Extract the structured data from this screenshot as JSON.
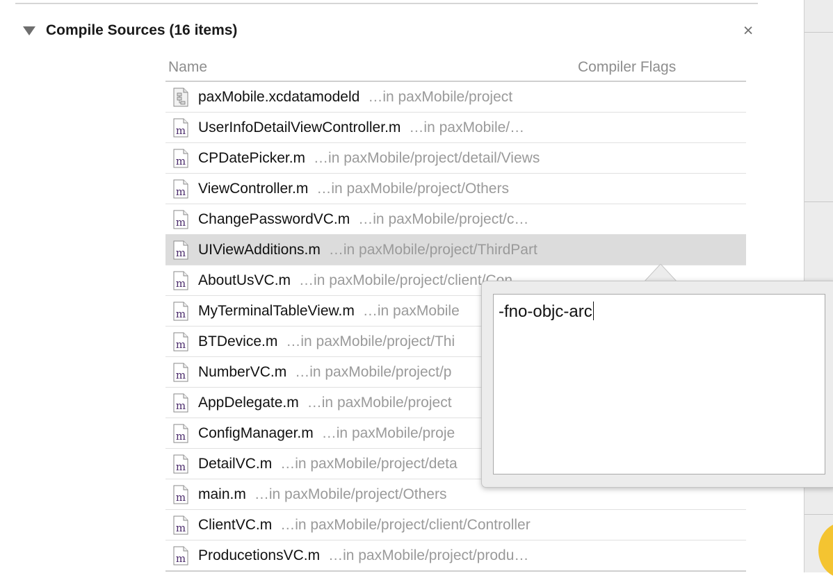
{
  "section": {
    "title": "Compile Sources (16 items)",
    "close_glyph": "×"
  },
  "columns": {
    "name": "Name",
    "flags": "Compiler Flags"
  },
  "files": [
    {
      "name": "paxMobile.xcdatamodeld",
      "path": "…in paxMobile/project",
      "icon": "datamodel-file-icon"
    },
    {
      "name": "UserInfoDetailViewController.m",
      "path": "…in paxMobile/…",
      "icon": "m-file-icon"
    },
    {
      "name": "CPDatePicker.m",
      "path": "…in paxMobile/project/detail/Views",
      "icon": "m-file-icon"
    },
    {
      "name": "ViewController.m",
      "path": "…in paxMobile/project/Others",
      "icon": "m-file-icon"
    },
    {
      "name": "ChangePasswordVC.m",
      "path": "…in paxMobile/project/c…",
      "icon": "m-file-icon"
    },
    {
      "name": "UIViewAdditions.m",
      "path": "…in paxMobile/project/ThirdPart",
      "icon": "m-file-icon",
      "selected": true
    },
    {
      "name": "AboutUsVC.m",
      "path": "…in paxMobile/project/client/Con",
      "icon": "m-file-icon"
    },
    {
      "name": "MyTerminalTableView.m",
      "path": "…in paxMobile",
      "icon": "m-file-icon"
    },
    {
      "name": "BTDevice.m",
      "path": "…in paxMobile/project/Thi",
      "icon": "m-file-icon"
    },
    {
      "name": "NumberVC.m",
      "path": "…in paxMobile/project/p",
      "icon": "m-file-icon"
    },
    {
      "name": "AppDelegate.m",
      "path": "…in paxMobile/project",
      "icon": "m-file-icon"
    },
    {
      "name": "ConfigManager.m",
      "path": "…in paxMobile/proje",
      "icon": "m-file-icon"
    },
    {
      "name": "DetailVC.m",
      "path": "…in paxMobile/project/deta",
      "icon": "m-file-icon"
    },
    {
      "name": "main.m",
      "path": "…in paxMobile/project/Others",
      "icon": "m-file-icon"
    },
    {
      "name": "ClientVC.m",
      "path": "…in paxMobile/project/client/Controller",
      "icon": "m-file-icon"
    },
    {
      "name": "ProducetionsVC.m",
      "path": "…in paxMobile/project/produ…",
      "icon": "m-file-icon"
    }
  ],
  "popover": {
    "flags_value": "-fno-objc-arc"
  }
}
